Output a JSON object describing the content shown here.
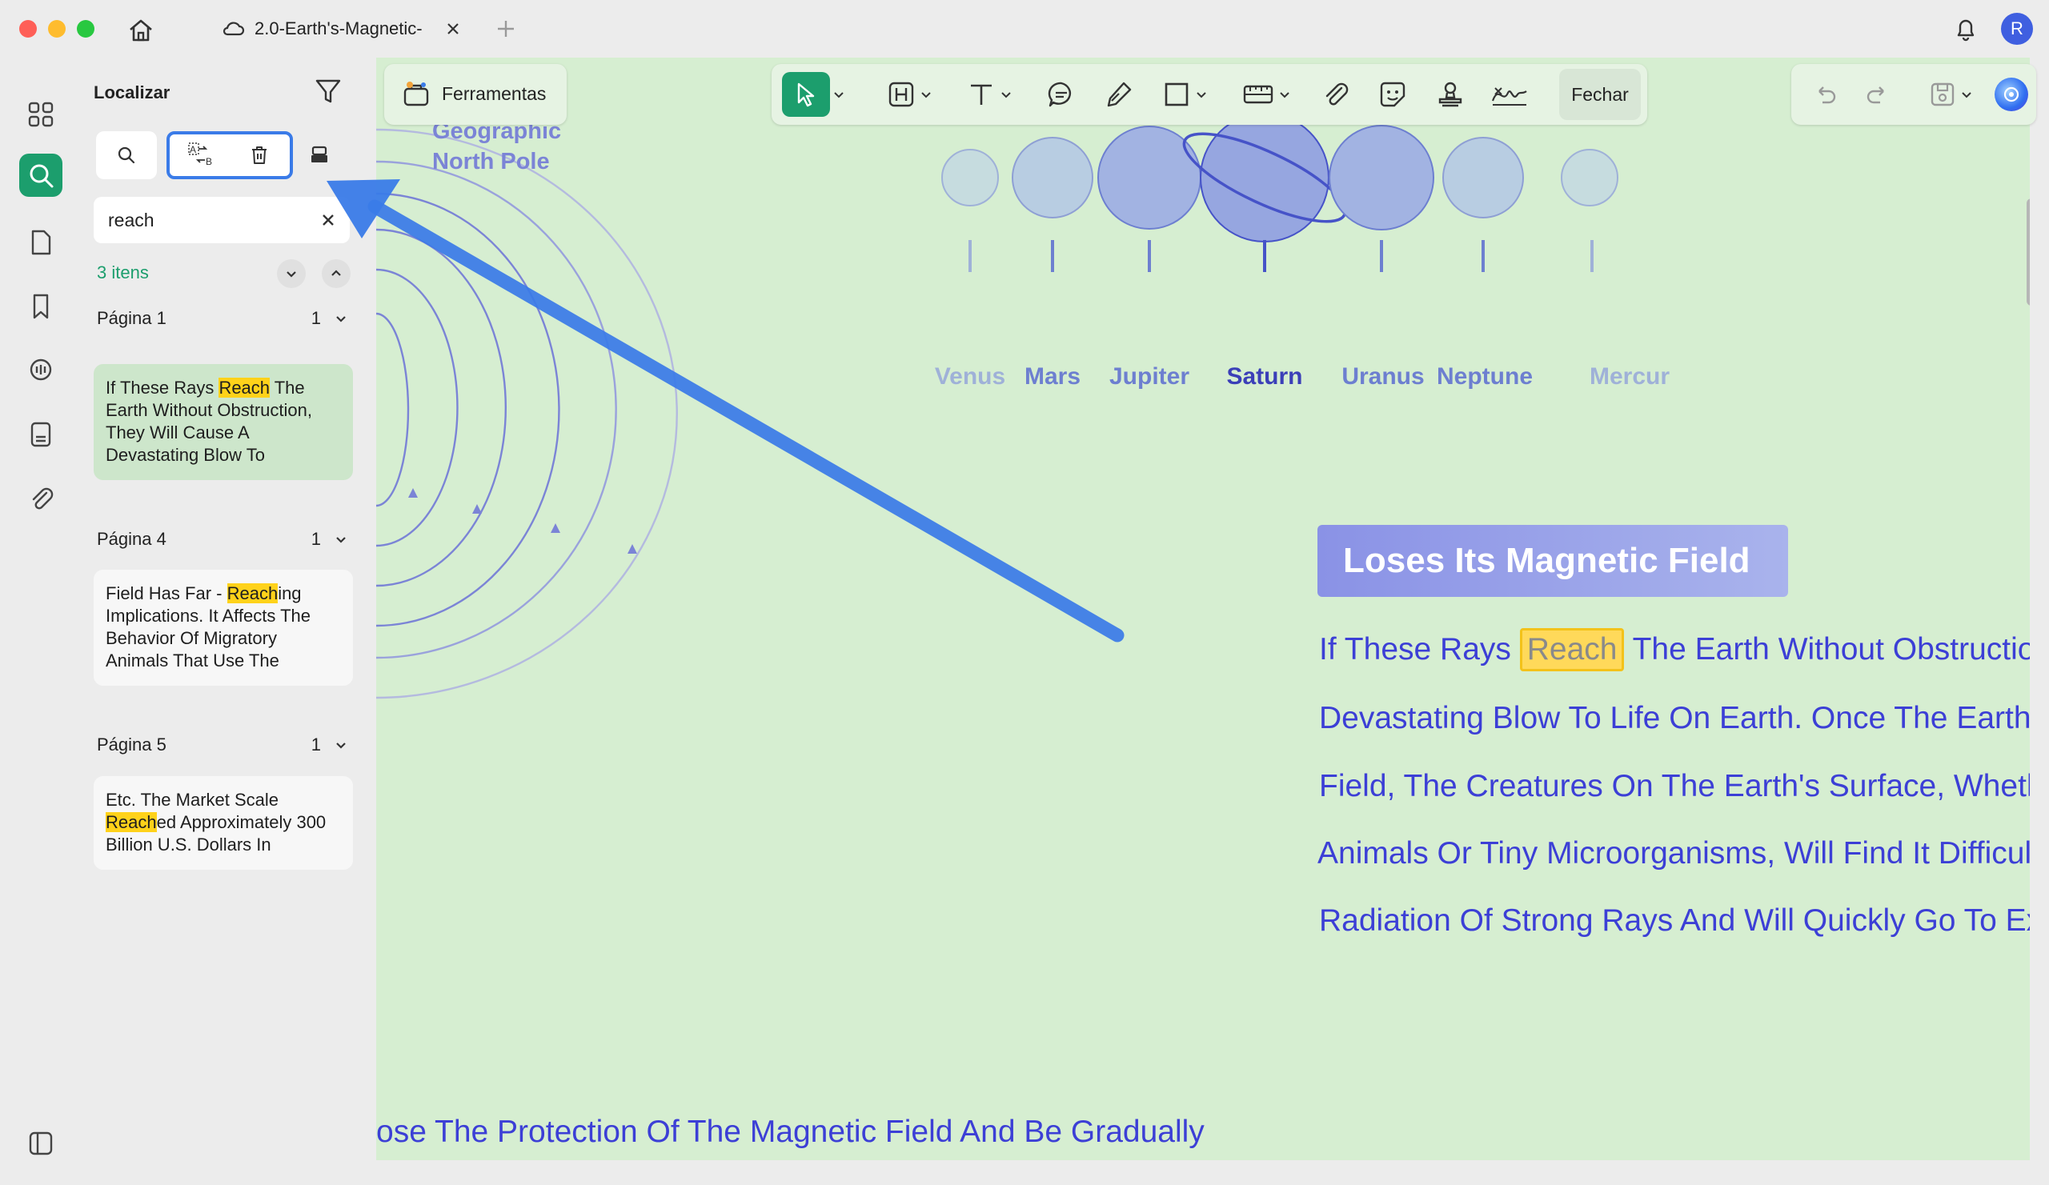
{
  "window": {
    "tab_title": "2.0-Earth's-Magnetic-",
    "avatar_letter": "R"
  },
  "sidebar_panel": {
    "title": "Localizar",
    "search_value": "reach",
    "results_count": "3 itens",
    "groups": [
      {
        "page_label": "Página 1",
        "count": "1",
        "before": "If These Rays ",
        "match": "Reach",
        "after": " The Earth Without Obstruction, They Will Cause A Devastating Blow To"
      },
      {
        "page_label": "Página 4",
        "count": "1",
        "before": "Field Has Far - ",
        "match": "Reach",
        "after": "ing Implications. It Affects The Behavior Of Migratory Animals That Use The"
      },
      {
        "page_label": "Página 5",
        "count": "1",
        "before": "Etc. The Market Scale ",
        "match": "Reach",
        "after": "ed Approximately 300 Billion U.S. Dollars In"
      }
    ]
  },
  "toolbar": {
    "tools_label": "Ferramentas",
    "close_label": "Fechar"
  },
  "document": {
    "pole_label_1": "Geographic",
    "pole_label_2": "North Pole",
    "planets": [
      "Venus",
      "Mars",
      "Jupiter",
      "Saturn",
      "Uranus",
      "Neptune",
      "Mercur"
    ],
    "heading": "Loses Its Magnetic Field",
    "heading_prefix": "L",
    "body_lines": [
      {
        "before": "If These Rays ",
        "match": "Reach",
        "after": " The Earth Without Obstruction, They Will Cause A"
      },
      {
        "text": "Devastating Blow To Life On Earth. Once The Earth Loses Its Magnetic"
      },
      {
        "text": "Field, The Creatures On The Earth's Surface, Whether Complex Plants And"
      },
      {
        "text": "Animals Or Tiny Microorganisms, Will Find It Difficult To Survive Under The"
      },
      {
        "text": "Radiation Of Strong Rays And Will Quickly Go To Extinction."
      }
    ],
    "bottom_line": "ose The Protection Of The Magnetic Field And Be Gradually"
  },
  "colors": {
    "accent": "#3a7be8",
    "highlight": "#ffd21a",
    "doc_bg": "#d6eed1",
    "doc_text": "#3c3fd6",
    "search_active": "#1c9e6d"
  }
}
